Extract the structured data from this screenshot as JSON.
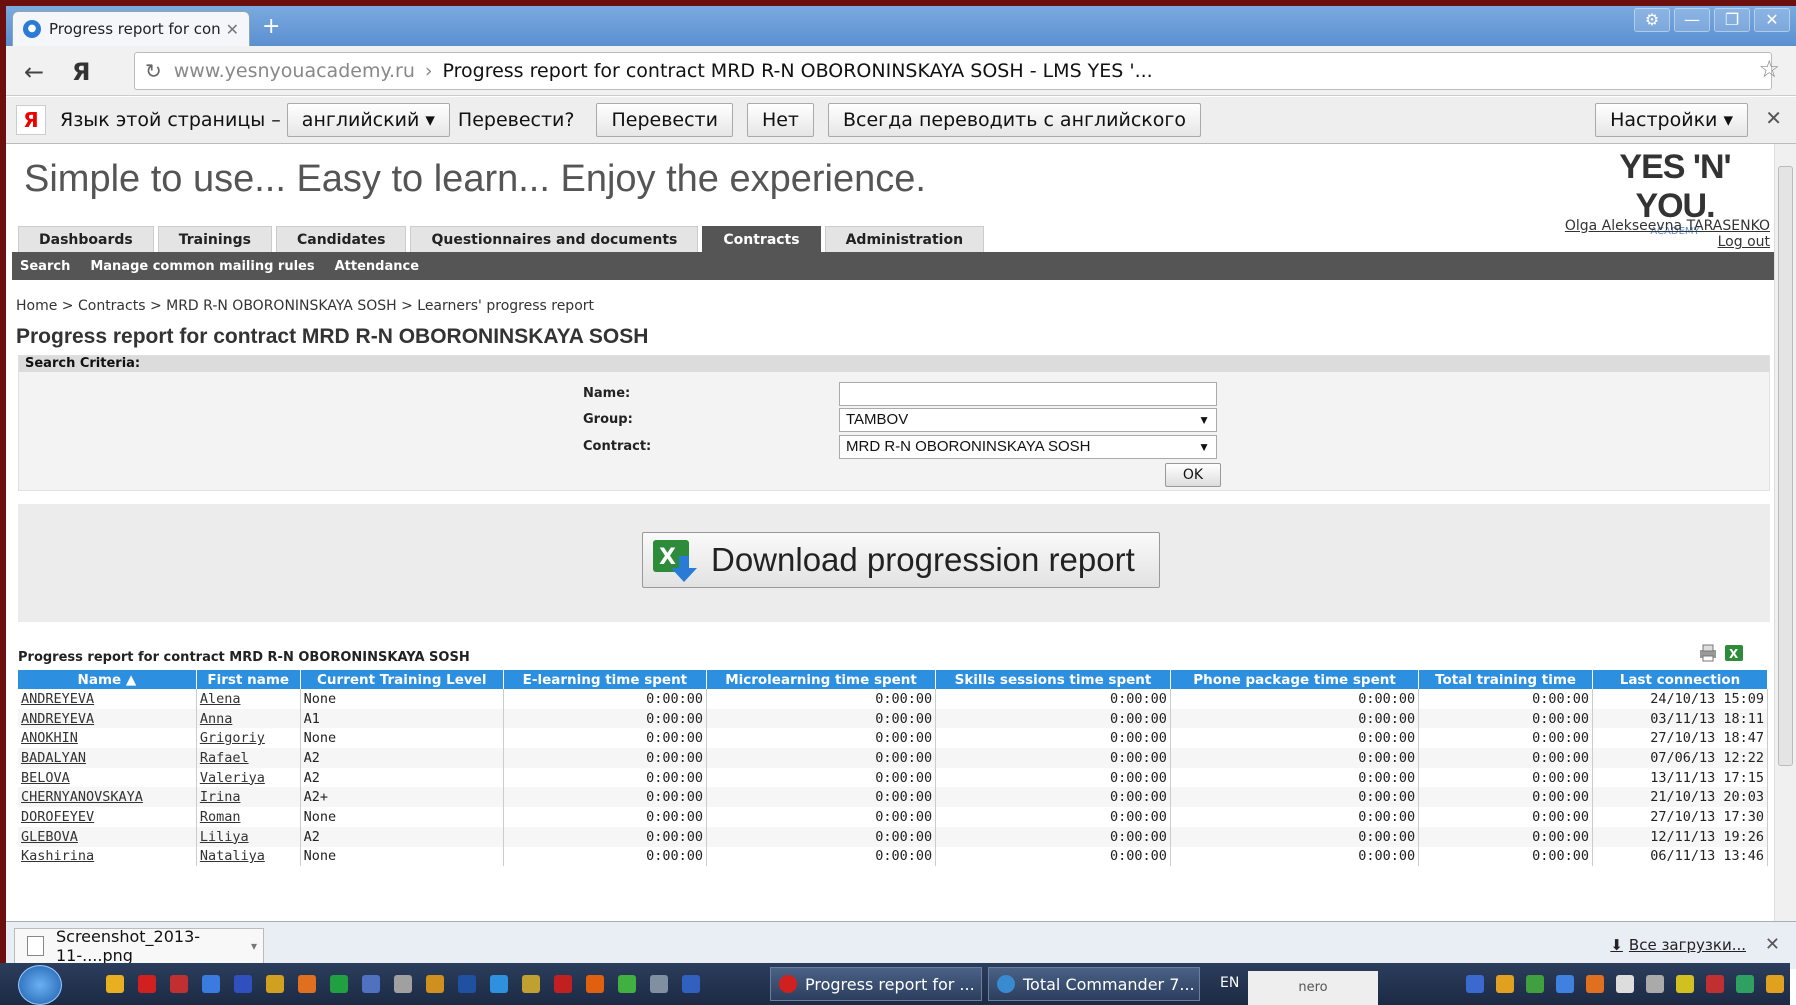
{
  "browser": {
    "tab_title": "Progress report for contr",
    "new_tab": "+",
    "url_domain": "www.yesnyouacademy.ru",
    "url_sep": "›",
    "page_title": "Progress report for contract MRD R-N OBORONINSKAYA SOSH - LMS YES '..."
  },
  "translate_bar": {
    "lang_prefix": "Язык этой страницы –",
    "lang_select": "английский",
    "question": "Перевести?",
    "translate_btn": "Перевести",
    "no_btn": "Нет",
    "always_btn": "Всегда переводить с английского",
    "settings_btn": "Настройки"
  },
  "site": {
    "tagline": "Simple to use... Easy to learn... Enjoy the experience.",
    "logo_main": "YES 'N' YOU.",
    "logo_sub": "ACADEMY",
    "user_name": "Olga Alekseevna TARASENKO",
    "logout": "Log out",
    "nav": [
      "Dashboards",
      "Trainings",
      "Candidates",
      "Questionnaires and documents",
      "Contracts",
      "Administration"
    ],
    "active_nav": "Contracts",
    "subnav": [
      "Search",
      "Manage common mailing rules",
      "Attendance"
    ]
  },
  "breadcrumb": "Home > Contracts > MRD R-N OBORONINSKAYA SOSH > Learners' progress report",
  "heading": "Progress report for contract MRD R-N OBORONINSKAYA SOSH",
  "search": {
    "header": "Search Criteria:",
    "name_label": "Name:",
    "name_value": "",
    "group_label": "Group:",
    "group_value": "TAMBOV",
    "contract_label": "Contract:",
    "contract_value": "MRD R-N OBORONINSKAYA SOSH",
    "ok_label": "OK"
  },
  "download_label": "Download progression report",
  "table": {
    "title": "Progress report for contract MRD R-N OBORONINSKAYA SOSH",
    "headers": [
      "Name ▲",
      "First name",
      "Current Training Level",
      "E-learning time spent",
      "Microlearning time spent",
      "Skills sessions time spent",
      "Phone package time spent",
      "Total training time",
      "Last connection"
    ],
    "rows": [
      [
        "ANDREYEVA",
        "Alena",
        "None",
        "0:00:00",
        "0:00:00",
        "0:00:00",
        "0:00:00",
        "0:00:00",
        "24/10/13 15:09"
      ],
      [
        "ANDREYEVA",
        "Anna",
        "A1",
        "0:00:00",
        "0:00:00",
        "0:00:00",
        "0:00:00",
        "0:00:00",
        "03/11/13 18:11"
      ],
      [
        "ANOKHIN",
        "Grigoriy",
        "None",
        "0:00:00",
        "0:00:00",
        "0:00:00",
        "0:00:00",
        "0:00:00",
        "27/10/13 18:47"
      ],
      [
        "BADALYAN",
        "Rafael",
        "A2",
        "0:00:00",
        "0:00:00",
        "0:00:00",
        "0:00:00",
        "0:00:00",
        "07/06/13 12:22"
      ],
      [
        "BELOVA",
        "Valeriya",
        "A2",
        "0:00:00",
        "0:00:00",
        "0:00:00",
        "0:00:00",
        "0:00:00",
        "13/11/13 17:15"
      ],
      [
        "CHERNYANOVSKAYA",
        "Irina",
        "A2+",
        "0:00:00",
        "0:00:00",
        "0:00:00",
        "0:00:00",
        "0:00:00",
        "21/10/13 20:03"
      ],
      [
        "DOROFEYEV",
        "Roman",
        "None",
        "0:00:00",
        "0:00:00",
        "0:00:00",
        "0:00:00",
        "0:00:00",
        "27/10/13 17:30"
      ],
      [
        "GLEBOVA",
        "Liliya",
        "A2",
        "0:00:00",
        "0:00:00",
        "0:00:00",
        "0:00:00",
        "0:00:00",
        "12/11/13 19:26"
      ],
      [
        "Kashirina",
        "Nataliya",
        "None",
        "0:00:00",
        "0:00:00",
        "0:00:00",
        "0:00:00",
        "0:00:00",
        "06/11/13 13:46"
      ]
    ]
  },
  "downloads": {
    "file": "Screenshot_2013-11-....png",
    "all": "Все загрузки..."
  },
  "taskbar": {
    "task1": "Progress report for ...",
    "task2": "Total Commander 7...",
    "lang": "EN",
    "nero": "nero"
  }
}
